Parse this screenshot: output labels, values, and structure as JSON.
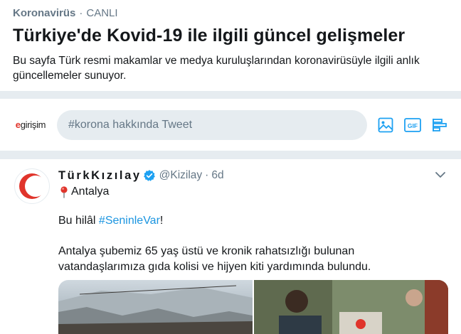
{
  "header": {
    "topic": "Koronavirüs",
    "separator": "·",
    "status": "CANLI",
    "title": "Türkiye'de Kovid-19 ile ilgili güncel gelişmeler",
    "description": "Bu sayfa Türk resmi makamlar ve medya kuruluşlarından koronavirüsüyle ilgili anlık güncellemeler sunuyor."
  },
  "compose": {
    "brand_prefix": "e",
    "brand_rest": "girişim",
    "placeholder": "#korona hakkında Tweet",
    "icons": [
      "image-icon",
      "gif-icon",
      "poll-icon"
    ],
    "gif_label": "GIF"
  },
  "tweet": {
    "display_name": "TürkKızılay",
    "handle": "@Kizilay",
    "separator": "·",
    "time": "6d",
    "location": "Antalya",
    "text1_prefix": "Bu hilâl ",
    "text1_hashtag": "#SeninleVar",
    "text1_suffix": "!",
    "text2": "Antalya şubemiz 65 yaş üstü ve kronik rahatsızlığı bulunan vatandaşlarımıza gıda kolisi ve hijyen kiti yardımında bulundu."
  },
  "colors": {
    "accent": "#1da1f2",
    "hashtag": "#1b95e0",
    "crescent": "#e0342b",
    "muted": "#657786",
    "background": "#e6ecf0"
  }
}
